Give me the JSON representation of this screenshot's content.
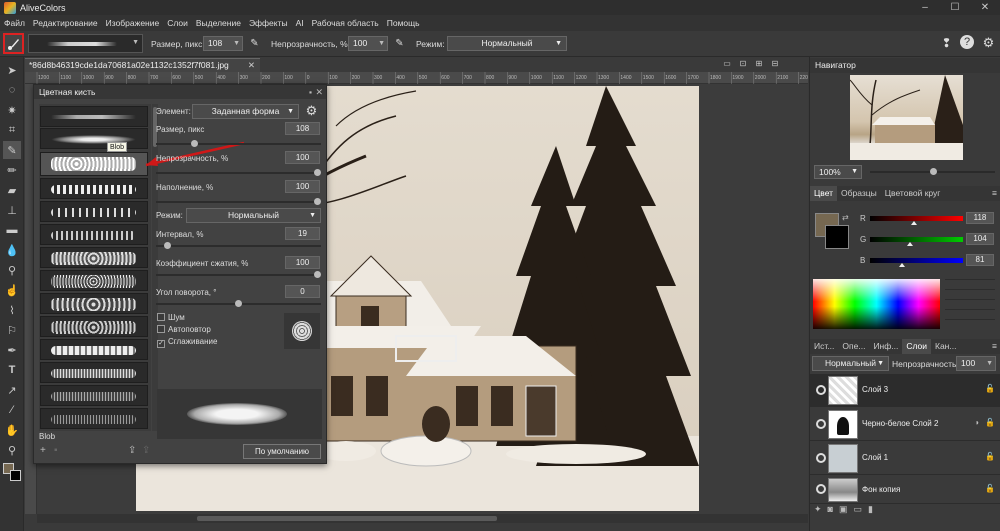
{
  "app": {
    "title": "AliveColors"
  },
  "menu": [
    "Файл",
    "Редактирование",
    "Изображение",
    "Слои",
    "Выделение",
    "Эффекты",
    "AI",
    "Рабочая область",
    "Помощь"
  ],
  "options": {
    "size_label": "Размер, пикс",
    "size_value": "108",
    "opacity_label": "Непрозрачность, %",
    "opacity_value": "100",
    "mode_label": "Режим:",
    "mode_value": "Нормальный"
  },
  "document": {
    "tab_title": "*86d8b46319cde1da70681a02e1132c1352f7f081.jpg"
  },
  "ruler_ticks": [
    "1200",
    "1100",
    "1000",
    "900",
    "800",
    "700",
    "600",
    "500",
    "400",
    "300",
    "200",
    "100",
    "0",
    "100",
    "200",
    "300",
    "400",
    "500",
    "600",
    "700",
    "800",
    "900",
    "1000",
    "1100",
    "1200",
    "1300",
    "1400",
    "1500",
    "1600",
    "1700",
    "1800",
    "1900",
    "2000",
    "2100",
    "2200"
  ],
  "brush_panel": {
    "title": "Цветная кисть",
    "tooltip": "Blob",
    "selected_name": "Blob",
    "element_label": "Элемент:",
    "element_value": "Заданная форма",
    "params": [
      {
        "label": "Размер, пикс",
        "value": "108",
        "level": 0.22
      },
      {
        "label": "Непрозрачность, %",
        "value": "100",
        "level": 1.0
      },
      {
        "label": "Наполнение, %",
        "value": "100",
        "level": 1.0
      }
    ],
    "mode_label": "Режим:",
    "mode_value": "Нормальный",
    "params2": [
      {
        "label": "Интервал, %",
        "value": "19",
        "level": 0.05
      },
      {
        "label": "Коэффициент сжатия, %",
        "value": "100",
        "level": 1.0
      },
      {
        "label": "Угол поворота, °",
        "value": "0",
        "level": 0.5
      }
    ],
    "checkboxes": [
      {
        "label": "Шум",
        "checked": false
      },
      {
        "label": "Автоповтор",
        "checked": false
      },
      {
        "label": "Сглаживание",
        "checked": true
      }
    ],
    "default_button": "По умолчанию"
  },
  "right": {
    "navigator_title": "Навигатор",
    "zoom": "100%",
    "color_tabs": [
      "Цвет",
      "Образцы",
      "Цветовой круг"
    ],
    "channels": [
      {
        "name": "R",
        "value": "118",
        "level": 0.46
      },
      {
        "name": "G",
        "value": "104",
        "level": 0.41
      },
      {
        "name": "B",
        "value": "81",
        "level": 0.32
      }
    ],
    "fg_color": "#766851",
    "layer_tabs": [
      "Ист...",
      "Опе...",
      "Инф...",
      "Слои",
      "Кан..."
    ],
    "blend_mode": "Нормальный",
    "opacity_label": "Непрозрачность",
    "opacity_value": "100",
    "layers": [
      {
        "name": "Слой 3"
      },
      {
        "name": "Черно-белое Слой 2"
      },
      {
        "name": "Слой 1"
      },
      {
        "name": "Фон копия"
      }
    ]
  }
}
